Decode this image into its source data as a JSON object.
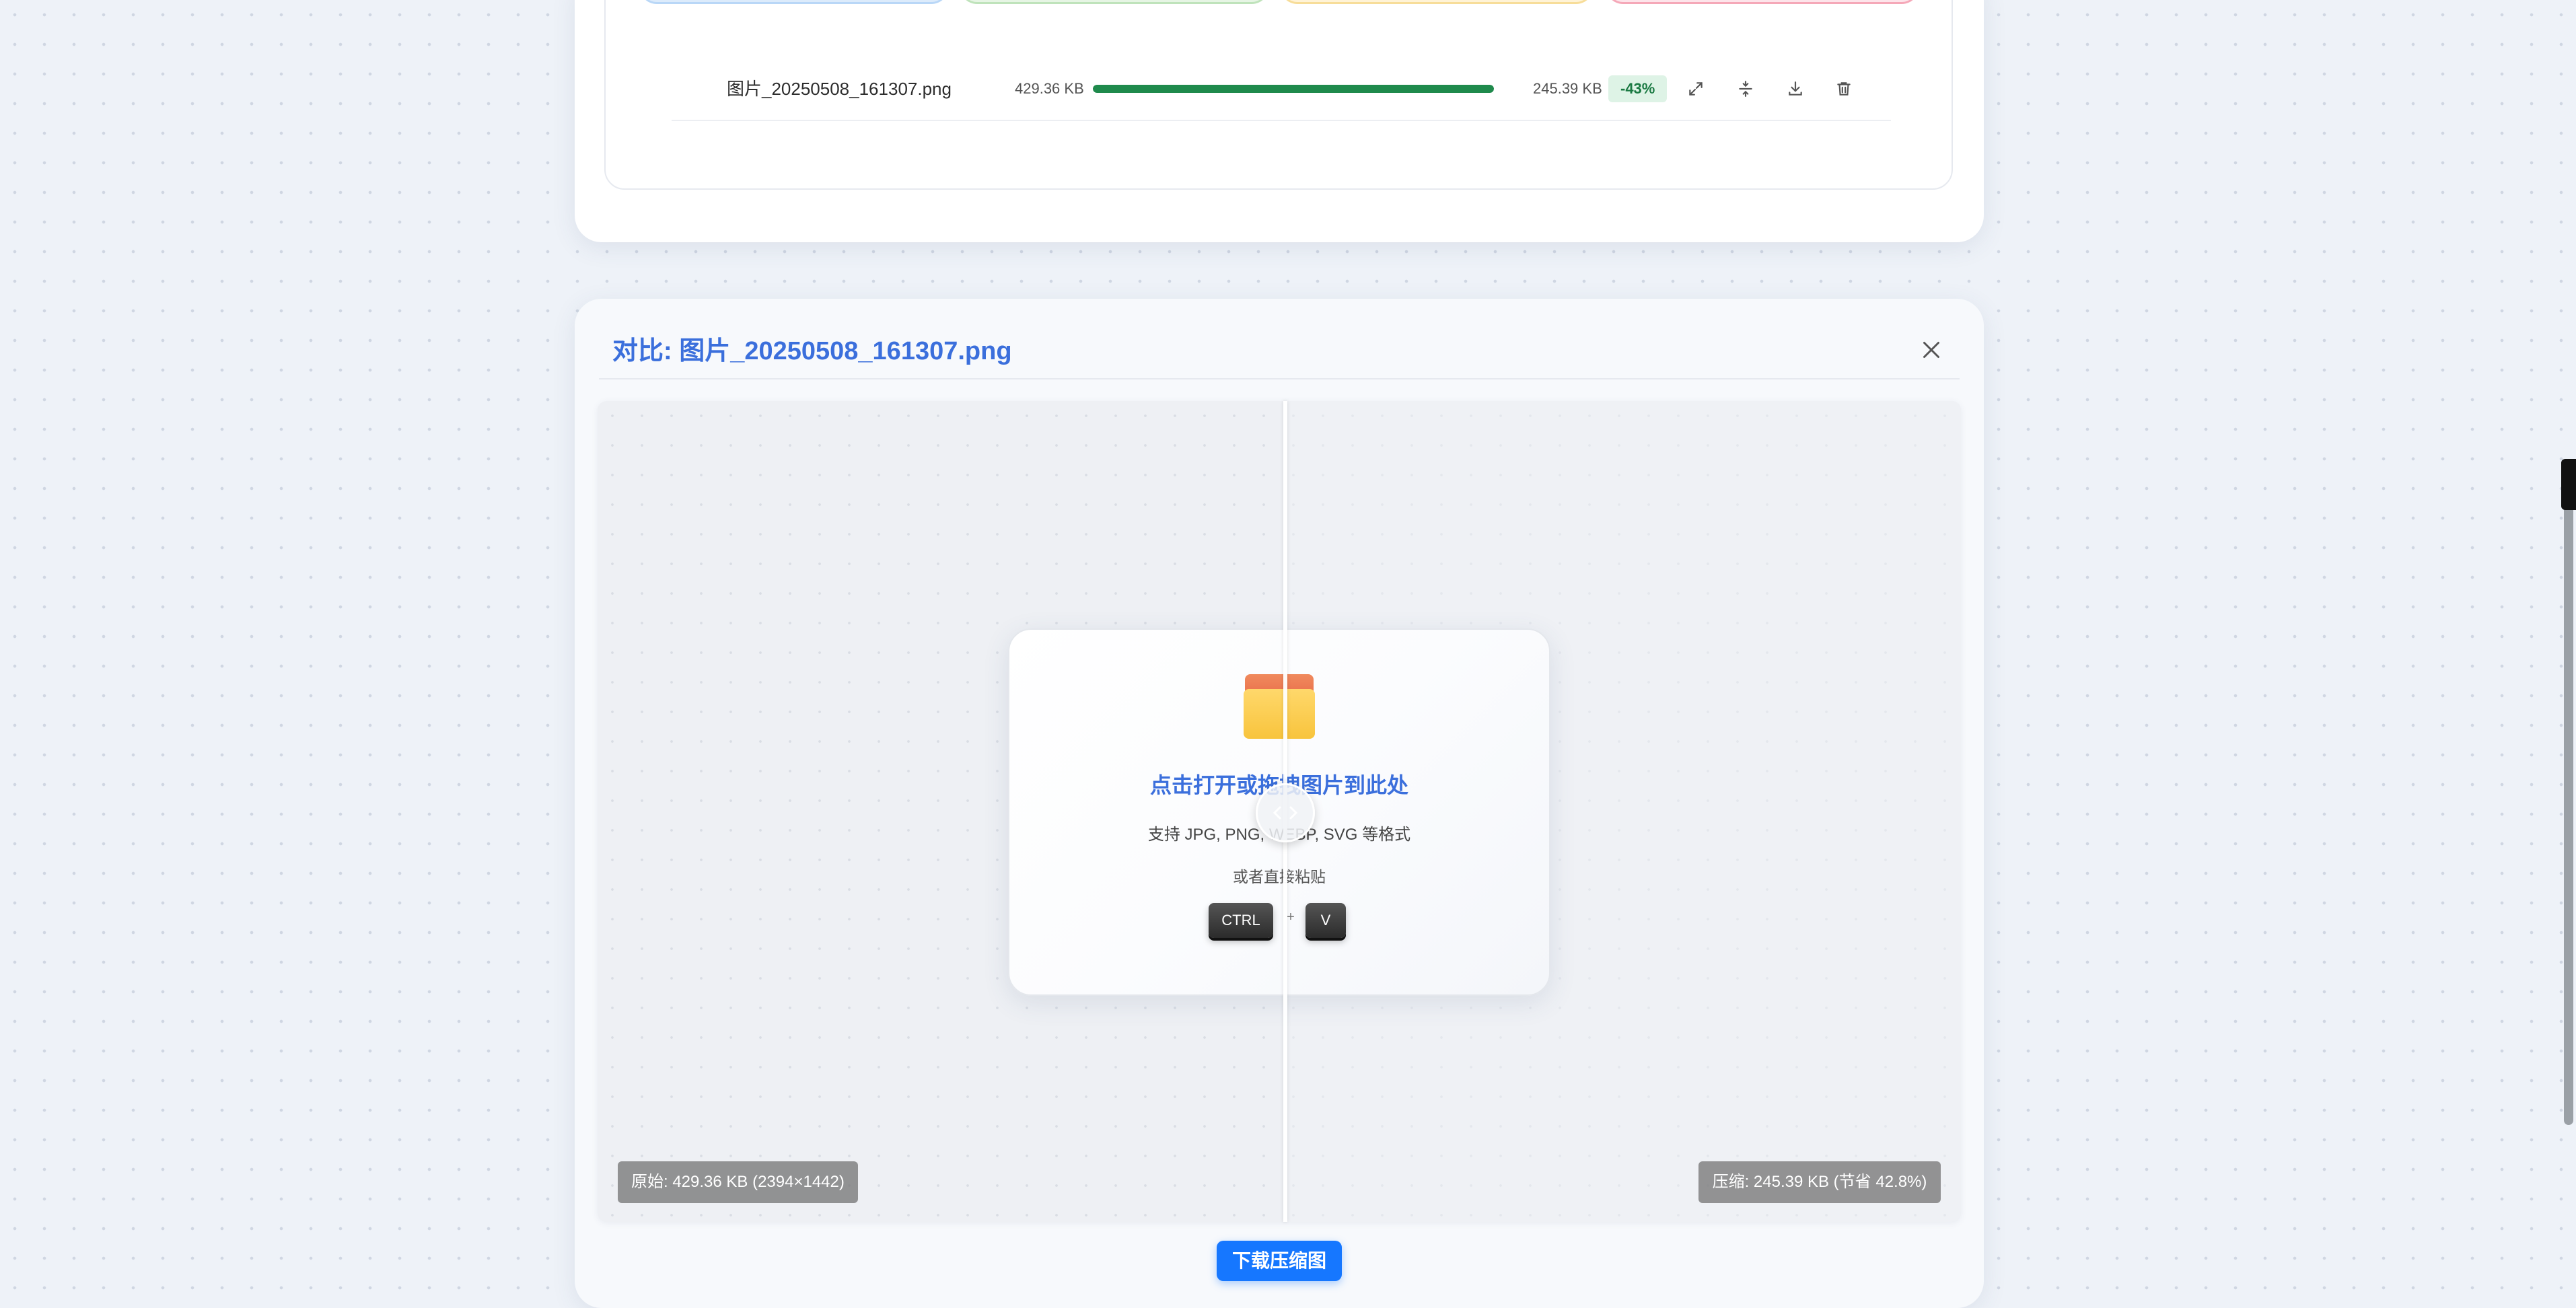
{
  "file_row": {
    "name": "图片_20250508_161307.png",
    "original_size": "429.36 KB",
    "compressed_size": "245.39 KB",
    "savings": "-43%",
    "progress_fraction": 1.0,
    "progress_color": "#1f8a4c"
  },
  "row_icons": [
    "expand-icon",
    "compress-icon",
    "download-icon",
    "trash-icon"
  ],
  "compare": {
    "title": "对比: 图片_20250508_161307.png",
    "original_label": "原始: 429.36 KB (2394×1442)",
    "compressed_label": "压缩: 245.39 KB (节省 42.8%)",
    "download_label": "下载压缩图"
  },
  "upload": {
    "heading": "点击打开或拖拽图片到此处",
    "formats": "支持 JPG, PNG, WEBP, SVG 等格式",
    "paste_hint": "或者直接粘贴",
    "key_ctrl": "CTRL",
    "key_plus": "+",
    "key_v": "V"
  },
  "colors": {
    "accent": "#3b6fdc",
    "primary_button": "#1677ff",
    "success_badge_bg": "#def3e6",
    "success_badge_text": "#1b7a43"
  }
}
